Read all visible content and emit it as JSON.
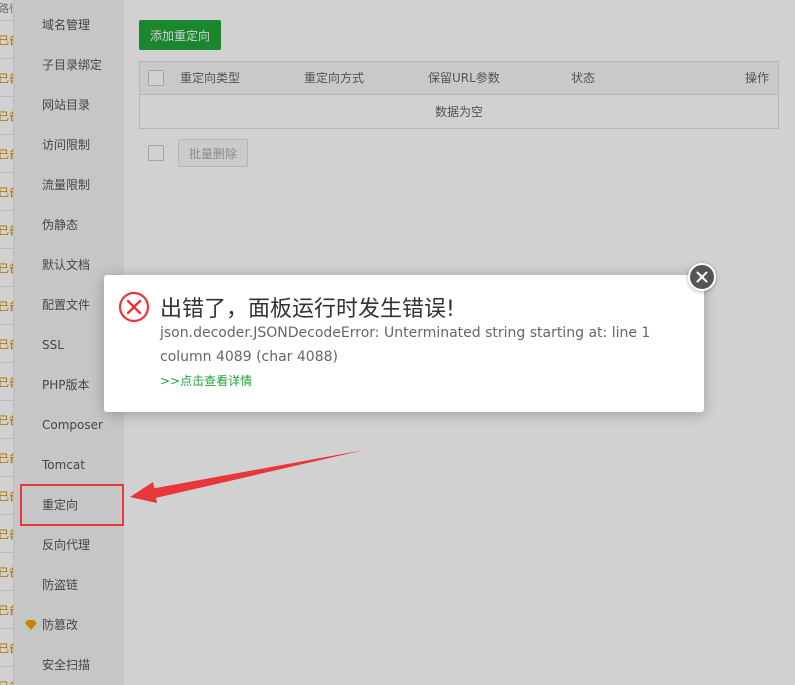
{
  "sidebar": {
    "items": [
      {
        "label": "域名管理"
      },
      {
        "label": "子目录绑定"
      },
      {
        "label": "网站目录"
      },
      {
        "label": "访问限制"
      },
      {
        "label": "流量限制"
      },
      {
        "label": "伪静态"
      },
      {
        "label": "默认文档"
      },
      {
        "label": "配置文件"
      },
      {
        "label": "SSL"
      },
      {
        "label": "PHP版本"
      },
      {
        "label": "Composer"
      },
      {
        "label": "Tomcat"
      },
      {
        "label": "重定向"
      },
      {
        "label": "反向代理"
      },
      {
        "label": "防盗链"
      },
      {
        "label": "防篡改",
        "icon": "diamond-icon"
      },
      {
        "label": "安全扫描"
      }
    ],
    "selected": "重定向"
  },
  "left_strip": {
    "fragments": [
      "路径",
      "已备"
    ]
  },
  "main": {
    "add_button": "添加重定向",
    "table": {
      "columns": [
        "重定向类型",
        "重定向方式",
        "保留URL参数",
        "状态",
        "操作"
      ],
      "empty_text": "数据为空"
    },
    "batch_delete_button": "批量删除"
  },
  "dialog": {
    "title": "出错了，面板运行时发生错误!",
    "message": "json.decoder.JSONDecodeError: Unterminated string starting at: line 1 column 4089 (char 4088)",
    "detail_link": ">>点击查看详情",
    "icon": "error-x-icon"
  },
  "colors": {
    "primary_green": "#20a53a",
    "error_red": "#e8363a",
    "annotation_red": "#e8363a"
  }
}
